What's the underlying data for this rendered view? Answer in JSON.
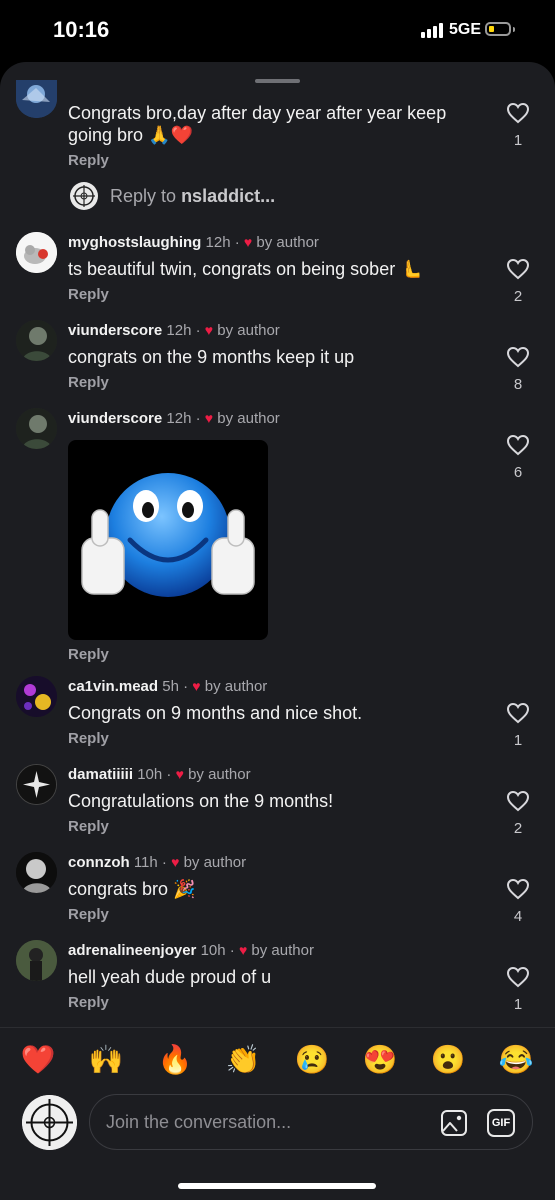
{
  "status_bar": {
    "time": "10:16",
    "network": "5GE"
  },
  "comments": [
    {
      "text": "Congrats bro,day after day year after year keep going bro 🙏❤️",
      "reply": "Reply",
      "likes": "1"
    },
    {
      "user": "myghostslaughing",
      "age": "12h",
      "author_tag": "by author",
      "text": "ts beautiful twin, congrats on being sober 🫷",
      "reply": "Reply",
      "likes": "2"
    },
    {
      "user": "viunderscore",
      "age": "12h",
      "author_tag": "by author",
      "text": "congrats on the 9 months keep it up",
      "reply": "Reply",
      "likes": "8"
    },
    {
      "user": "viunderscore",
      "age": "12h",
      "author_tag": "by author",
      "text": "",
      "reply": "Reply",
      "likes": "6"
    },
    {
      "user": "ca1vin.mead",
      "age": "5h",
      "author_tag": "by author",
      "text": "Congrats on 9 months and nice shot.",
      "reply": "Reply",
      "likes": "1"
    },
    {
      "user": "damatiiiii",
      "age": "10h",
      "author_tag": "by author",
      "text": "Congratulations on the 9 months!",
      "reply": "Reply",
      "likes": "2"
    },
    {
      "user": "connzoh",
      "age": "11h",
      "author_tag": "by author",
      "text": "congrats bro 🎉",
      "reply": "Reply",
      "likes": "4"
    },
    {
      "user": "adrenalineenjoyer",
      "age": "10h",
      "author_tag": "by author",
      "text": "hell yeah dude proud of u",
      "reply": "Reply",
      "likes": "1"
    }
  ],
  "reply_to": {
    "prefix": "Reply to",
    "user": "nsladdict..."
  },
  "quick_reactions": [
    "❤️",
    "🙌",
    "🔥",
    "👏",
    "😢",
    "😍",
    "😮",
    "😂"
  ],
  "composer": {
    "placeholder": "Join the conversation...",
    "gif_label": "GIF"
  },
  "colors": {
    "sheet_bg": "#1c1d21",
    "heart": "#ed1d45",
    "muted": "#a8a8ad"
  }
}
